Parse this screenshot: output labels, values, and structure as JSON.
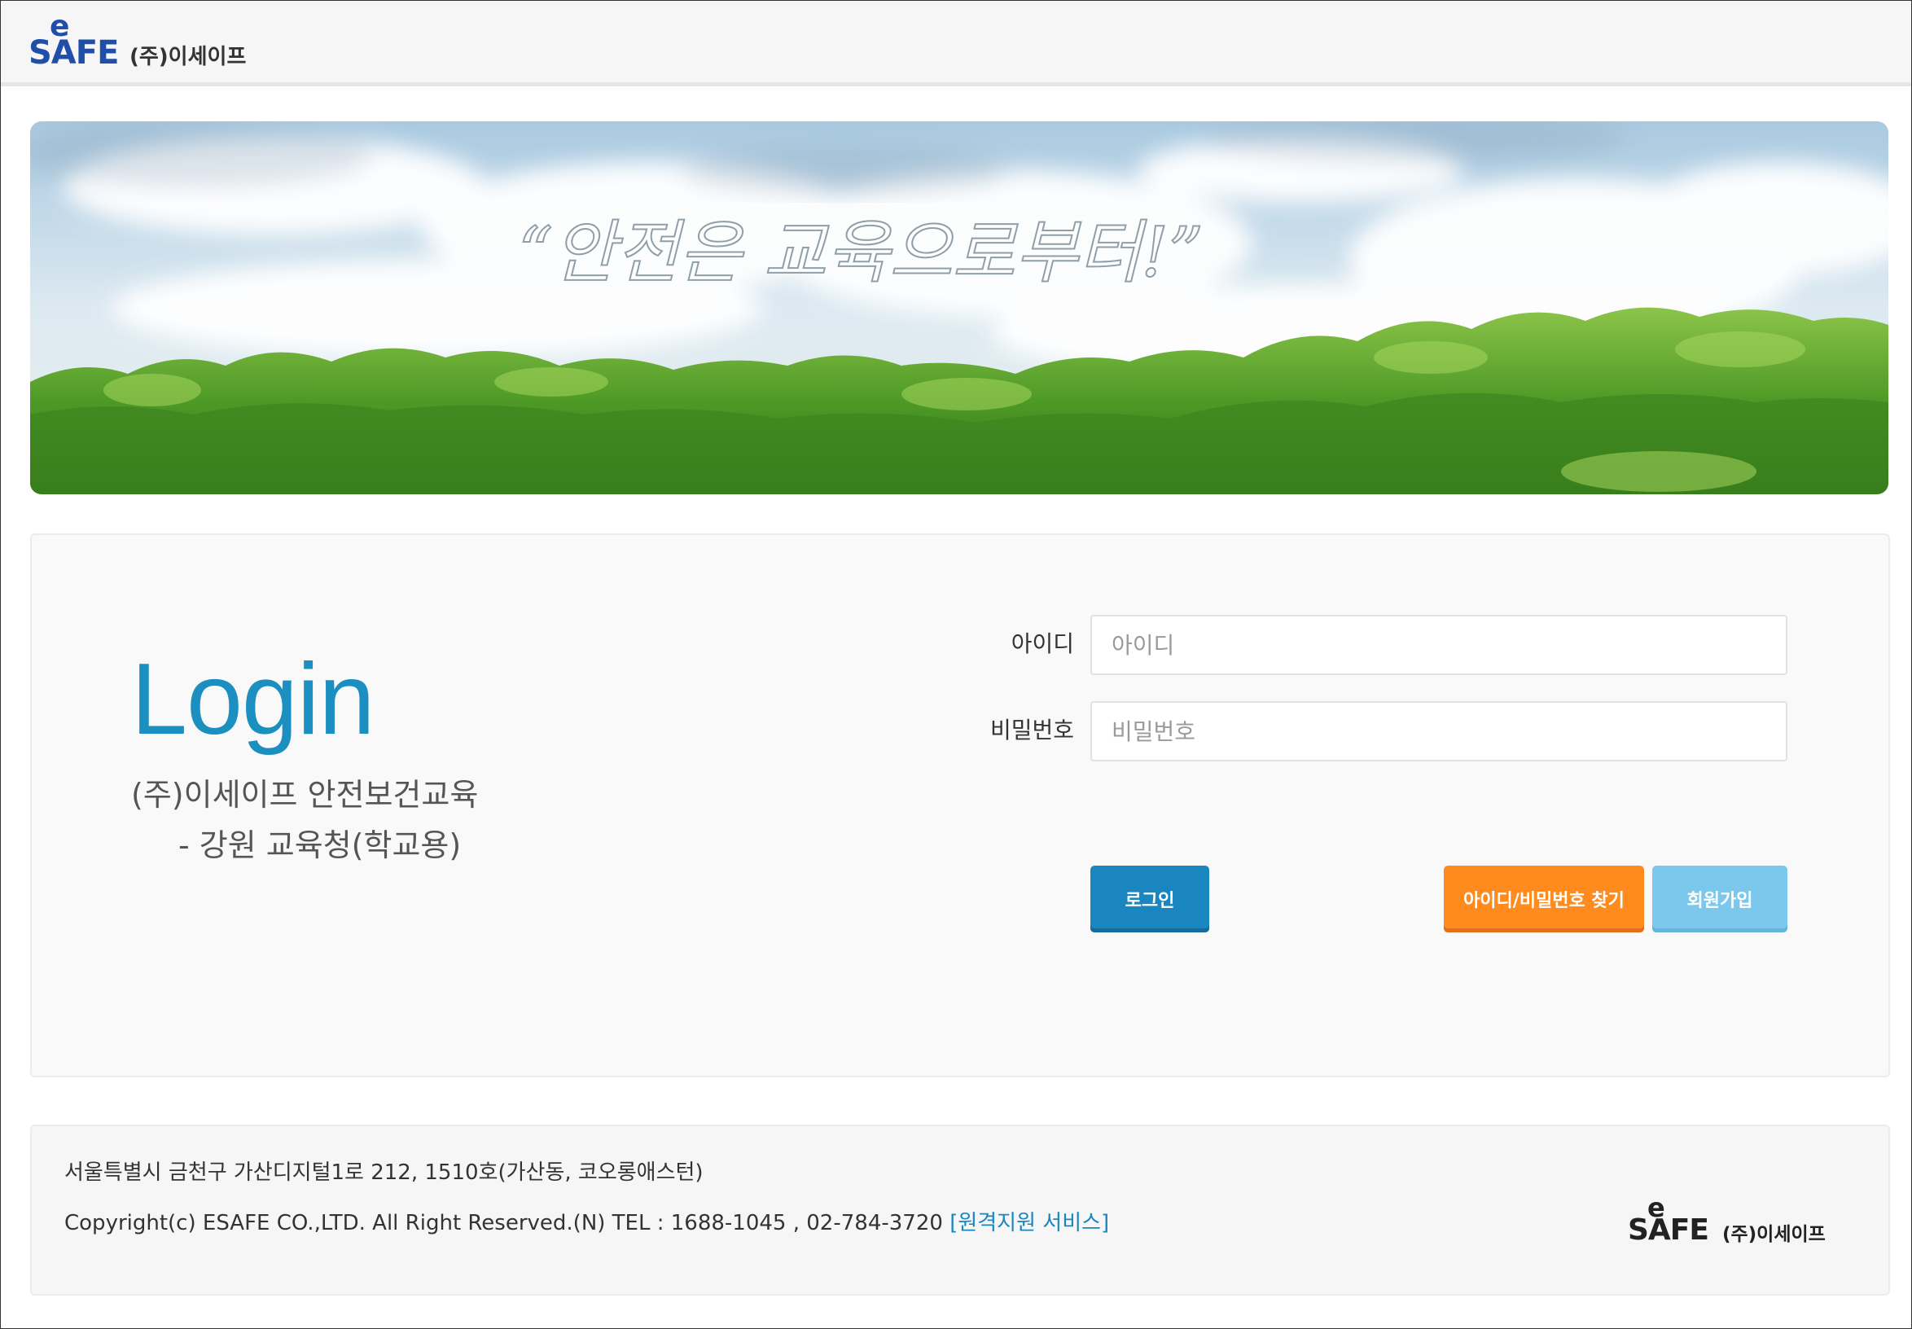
{
  "header": {
    "logo_e": "e",
    "logo_brand": "SAFE",
    "logo_company": "(주)이세이프"
  },
  "banner": {
    "slogan": "“안전은 교육으로부터!”"
  },
  "login": {
    "title": "Login",
    "subtitle_line1": "(주)이세이프 안전보건교육",
    "subtitle_line2": "- 강원 교육청(학교용)",
    "id_label": "아이디",
    "id_placeholder": "아이디",
    "id_value": "",
    "pw_label": "비밀번호",
    "pw_placeholder": "비밀번호",
    "pw_value": "",
    "login_button": "로그인",
    "find_button": "아이디/비밀번호 찾기",
    "join_button": "회원가입"
  },
  "footer": {
    "address": "서울특별시 금천구 가산디지털1로 212, 1510호(가산동, 코오롱애스턴)",
    "copyright": "Copyright(c) ESAFE CO.,LTD. All Right Reserved.(N) TEL : 1688-1045 , 02-784-3720 ",
    "remote_link": "[원격지원 서비스]",
    "logo_e": "e",
    "logo_brand": "SAFE",
    "logo_company": "(주)이세이프"
  },
  "colors": {
    "accent": "#1a86c0",
    "find_button": "#ff8a1e",
    "join_button": "#7cc8ed",
    "title": "#1a8fc0"
  }
}
